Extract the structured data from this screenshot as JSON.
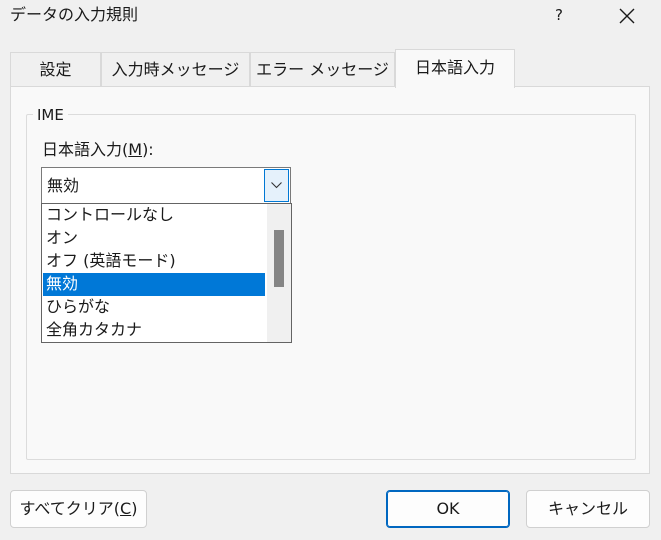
{
  "window": {
    "title": "データの入力規則",
    "help_label": "?"
  },
  "tabs": [
    {
      "label": "設定",
      "active": false
    },
    {
      "label": "入力時メッセージ",
      "active": false
    },
    {
      "label": "エラー メッセージ",
      "active": false
    },
    {
      "label": "日本語入力",
      "active": true
    }
  ],
  "ime_group": {
    "legend": "IME",
    "field_label_prefix": "日本語入力(",
    "field_label_mnemonic": "M",
    "field_label_suffix": "):",
    "selected_value": "無効",
    "options": [
      "コントロールなし",
      "オン",
      "オフ (英語モード)",
      "無効",
      "ひらがな",
      "全角カタカナ"
    ],
    "selected_index": 3
  },
  "buttons": {
    "clear_all_prefix": "すべてクリア(",
    "clear_all_mnemonic": "C",
    "clear_all_suffix": ")",
    "ok": "OK",
    "cancel": "キャンセル"
  },
  "colors": {
    "accent": "#0078d7",
    "dialog_bg": "#f0f0f0",
    "panel_bg": "#f9f9f9"
  }
}
